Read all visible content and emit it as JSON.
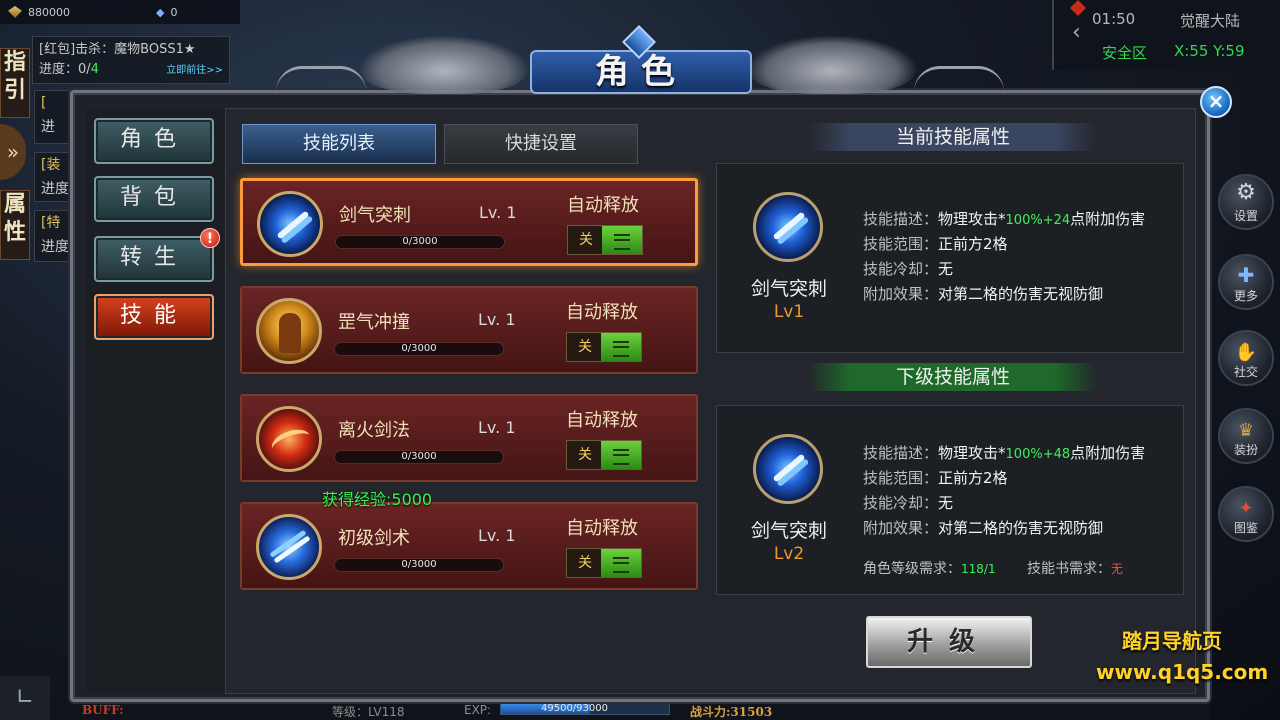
{
  "hud": {
    "gold": "880000",
    "diamond": "0",
    "quest": {
      "title": "[红包]击杀：魔物BOSS1★",
      "progress_label": "进度：0/",
      "progress_value": "4",
      "link": "立即前往>>"
    },
    "quest_partials": [
      {
        "label": "[装",
        "progress": "进度"
      },
      {
        "label": "[特",
        "progress": "进度"
      }
    ],
    "left_tabs": [
      "指引",
      "属性"
    ],
    "map": {
      "time": "01:50",
      "zone": "觉醒大陆",
      "safe": "安全区",
      "coord": "X:55 Y:59"
    },
    "side_buttons": [
      "设置",
      "更多",
      "社交",
      "装扮",
      "图鉴"
    ],
    "bottom": {
      "buff": "BUFF:",
      "level": "等级：LV118",
      "exp_label": "EXP:",
      "exp_value": "49500/93000",
      "exp_fraction": 0.532,
      "power": "战斗力:31503"
    }
  },
  "window": {
    "title": "角色",
    "close": "×"
  },
  "nav": {
    "items": [
      {
        "label": "角色",
        "active": false
      },
      {
        "label": "背包",
        "active": false
      },
      {
        "label": "转生",
        "active": false,
        "badge": "!"
      },
      {
        "label": "技能",
        "active": true
      }
    ]
  },
  "tabs": {
    "skill_list": "技能列表",
    "shortcut": "快捷设置"
  },
  "skills": [
    {
      "name": "剑气突刺",
      "level": "Lv. 1",
      "exp": "0/3000",
      "auto_label": "自动释放",
      "toggle_off": "关",
      "icon": "sword-thrust-icon"
    },
    {
      "name": "罡气冲撞",
      "level": "Lv. 1",
      "exp": "0/3000",
      "auto_label": "自动释放",
      "toggle_off": "关",
      "icon": "warrior-charge-icon"
    },
    {
      "name": "离火剑法",
      "level": "Lv. 1",
      "exp": "0/3000",
      "auto_label": "自动释放",
      "toggle_off": "关",
      "icon": "fire-sword-icon"
    },
    {
      "name": "初级剑术",
      "level": "Lv. 1",
      "exp": "0/3000",
      "auto_label": "自动释放",
      "toggle_off": "关",
      "icon": "blade-skill-icon"
    }
  ],
  "gain_exp": "获得经验:5000",
  "current": {
    "section_title": "当前技能属性",
    "name": "剑气突刺",
    "level": "Lv1",
    "desc_key": "技能描述：",
    "desc_pre": "物理攻击*",
    "desc_val": "100%+24",
    "desc_post": "点附加伤害",
    "range_key": "技能范围：",
    "range_val": "正前方2格",
    "cd_key": "技能冷却：",
    "cd_val": "无",
    "effect_key": "附加效果：",
    "effect_val": "对第二格的伤害无视防御"
  },
  "next": {
    "section_title": "下级技能属性",
    "name": "剑气突刺",
    "level": "Lv2",
    "desc_key": "技能描述：",
    "desc_pre": "物理攻击*",
    "desc_val": "100%+48",
    "desc_post": "点附加伤害",
    "range_key": "技能范围：",
    "range_val": "正前方2格",
    "cd_key": "技能冷却：",
    "cd_val": "无",
    "effect_key": "附加效果：",
    "effect_val": "对第二格的伤害无视防御",
    "req_level_key": "角色等级需求：",
    "req_level_val": "118/1",
    "req_book_key": "技能书需求：",
    "req_book_val": "无"
  },
  "upgrade_button": "升级",
  "watermark": {
    "line1": "踏月导航页",
    "line2": "www.q1q5.com"
  }
}
